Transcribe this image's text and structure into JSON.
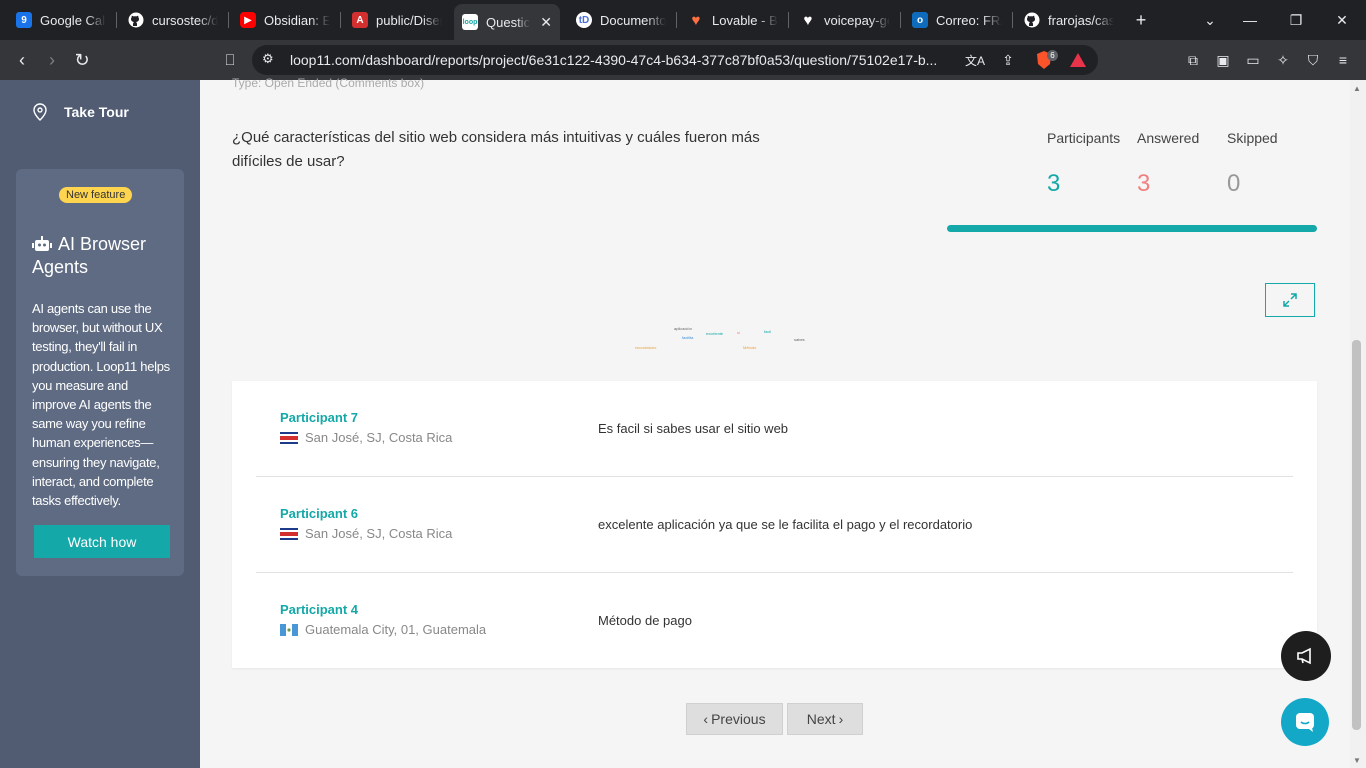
{
  "browser": {
    "tabs": [
      {
        "label": "Google Cale",
        "icon": "google-calendar-icon",
        "color": "#1a73e8"
      },
      {
        "label": "cursostec/d",
        "icon": "github-icon",
        "color": "#ffffff"
      },
      {
        "label": "Obsidian: El",
        "icon": "youtube-icon",
        "color": "#ff0000"
      },
      {
        "label": "public/Diser",
        "icon": "pdf-icon",
        "color": "#d32f2f"
      },
      {
        "label": "Questic",
        "icon": "loop11-icon",
        "color": "#14a8a8",
        "active": true
      },
      {
        "label": "Documento",
        "icon": "td-icon",
        "color": "#4a6fd8"
      },
      {
        "label": "Lovable - Bo",
        "icon": "lovable-heart-icon",
        "color": "#ff7043"
      },
      {
        "label": "voicepay-ge",
        "icon": "heart-icon",
        "color": "#ffffff"
      },
      {
        "label": "Correo: FRA",
        "icon": "outlook-icon",
        "color": "#0f6cbd"
      },
      {
        "label": "frarojas/cas",
        "icon": "github-icon",
        "color": "#ffffff"
      }
    ],
    "url": "loop11.com/dashboard/reports/project/6e31c122-4390-47c4-b634-377c87bf0a53/question/75102e17-b...",
    "brave_count": "6"
  },
  "sidebar": {
    "take_tour": "Take Tour",
    "promo": {
      "badge": "New feature",
      "title": "AI Browser Agents",
      "body": "AI agents can use the browser, but without UX testing, they'll fail in production. Loop11 helps you measure and improve AI agents the same way you refine human experiences—ensuring they navigate, interact, and complete tasks effectively.",
      "button": "Watch how"
    }
  },
  "main": {
    "type_line": "Type: Open Ended (Comments box)",
    "question": "¿Qué características del sitio web considera más intuitivas y cuáles fueron más difíciles de usar?",
    "stats": {
      "participants_label": "Participants",
      "participants_value": "3",
      "answered_label": "Answered",
      "answered_value": "3",
      "skipped_label": "Skipped",
      "skipped_value": "0"
    },
    "answered_progress": 1.0,
    "word_cloud": [
      "aplicación",
      "facilita",
      "excelente",
      "si",
      "facil",
      "sabes",
      "recordatorio",
      "Método"
    ],
    "responses": [
      {
        "participant": "Participant 7",
        "location": "San José, SJ, Costa Rica",
        "flag": "costa-rica-flag-icon",
        "answer": "Es facil si sabes usar el sitio web"
      },
      {
        "participant": "Participant 6",
        "location": "San José, SJ, Costa Rica",
        "flag": "costa-rica-flag-icon",
        "answer": "excelente aplicación ya que se le facilita el pago y el recordatorio"
      },
      {
        "participant": "Participant 4",
        "location": "Guatemala City, 01, Guatemala",
        "flag": "guatemala-flag-icon",
        "answer": "Método de pago"
      }
    ],
    "pagination": {
      "previous": "Previous",
      "next": "Next"
    }
  },
  "colors": {
    "accent": "#14a8a8",
    "answered": "#f08080",
    "skipped": "#999999",
    "sidebar": "#515c73"
  }
}
